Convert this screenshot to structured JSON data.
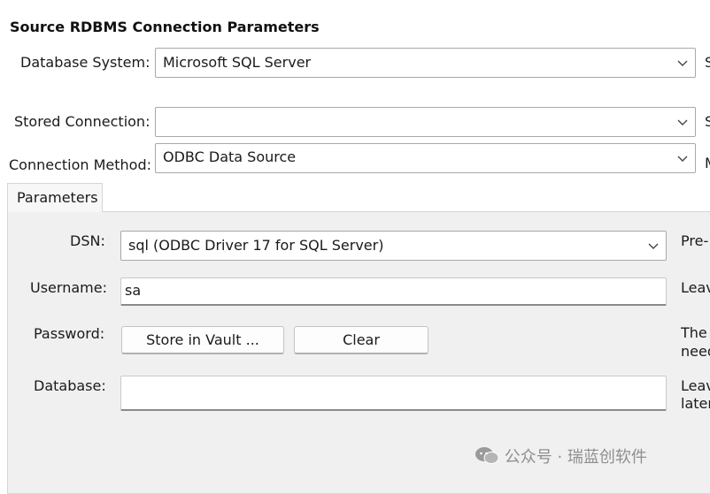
{
  "section_title": "Source RDBMS Connection Parameters",
  "database_system": {
    "label": "Database System:",
    "value": "Microsoft SQL Server",
    "side_text": "S"
  },
  "stored_connection": {
    "label": "Stored Connection:",
    "value": "",
    "side_text": "S"
  },
  "connection_method": {
    "label": "Connection Method:",
    "value": "ODBC Data Source",
    "side_text": "M"
  },
  "tabs": [
    {
      "label": "Parameters"
    }
  ],
  "params": {
    "dsn": {
      "label": "DSN:",
      "value": "sql (ODBC Driver 17 for SQL Server)",
      "side_text": "Pre-"
    },
    "username": {
      "label": "Username:",
      "value": "sa",
      "side_text": "Leav"
    },
    "password": {
      "label": "Password:",
      "store_button": "Store in Vault ...",
      "clear_button": "Clear",
      "side_text_1": "The",
      "side_text_2": "need"
    },
    "database": {
      "label": "Database:",
      "value": "",
      "side_text_1": "Leav",
      "side_text_2": "later"
    }
  },
  "watermark": "公众号 · 瑞蓝创软件"
}
